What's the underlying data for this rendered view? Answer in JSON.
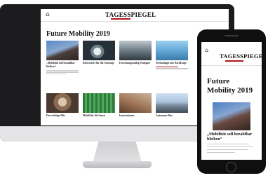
{
  "desktop": {
    "logo": "TAGESSPIEGEL",
    "kicker": "",
    "title": "Future Mobility 2019",
    "cards": [
      {
        "title": "„Mobilität soll bezahlbar bleiben“",
        "meta": ""
      },
      {
        "title": "Rückwärts für die Umfrage",
        "meta": ""
      },
      {
        "title": "Forschungskolleg Stuttgart",
        "meta": ""
      },
      {
        "title": "Technologie mit Nachfrage",
        "meta": ""
      },
      {
        "title": "Der richtige Mix",
        "meta": ""
      },
      {
        "title": "Mobil für die Innen",
        "meta": ""
      },
      {
        "title": "Innovationen",
        "meta": ""
      },
      {
        "title": "Autonome Bus",
        "meta": ""
      }
    ]
  },
  "phone": {
    "logo": "TAGESSPIEGEL",
    "kicker": "",
    "title": "Future Mobility 2019",
    "headline": "„Mobilität soll bezahlbar bleiben“"
  },
  "colors": {
    "device_dark": "#1c1c1e",
    "brand_red": "#b0151c"
  },
  "icons": {
    "home": "home-icon"
  }
}
